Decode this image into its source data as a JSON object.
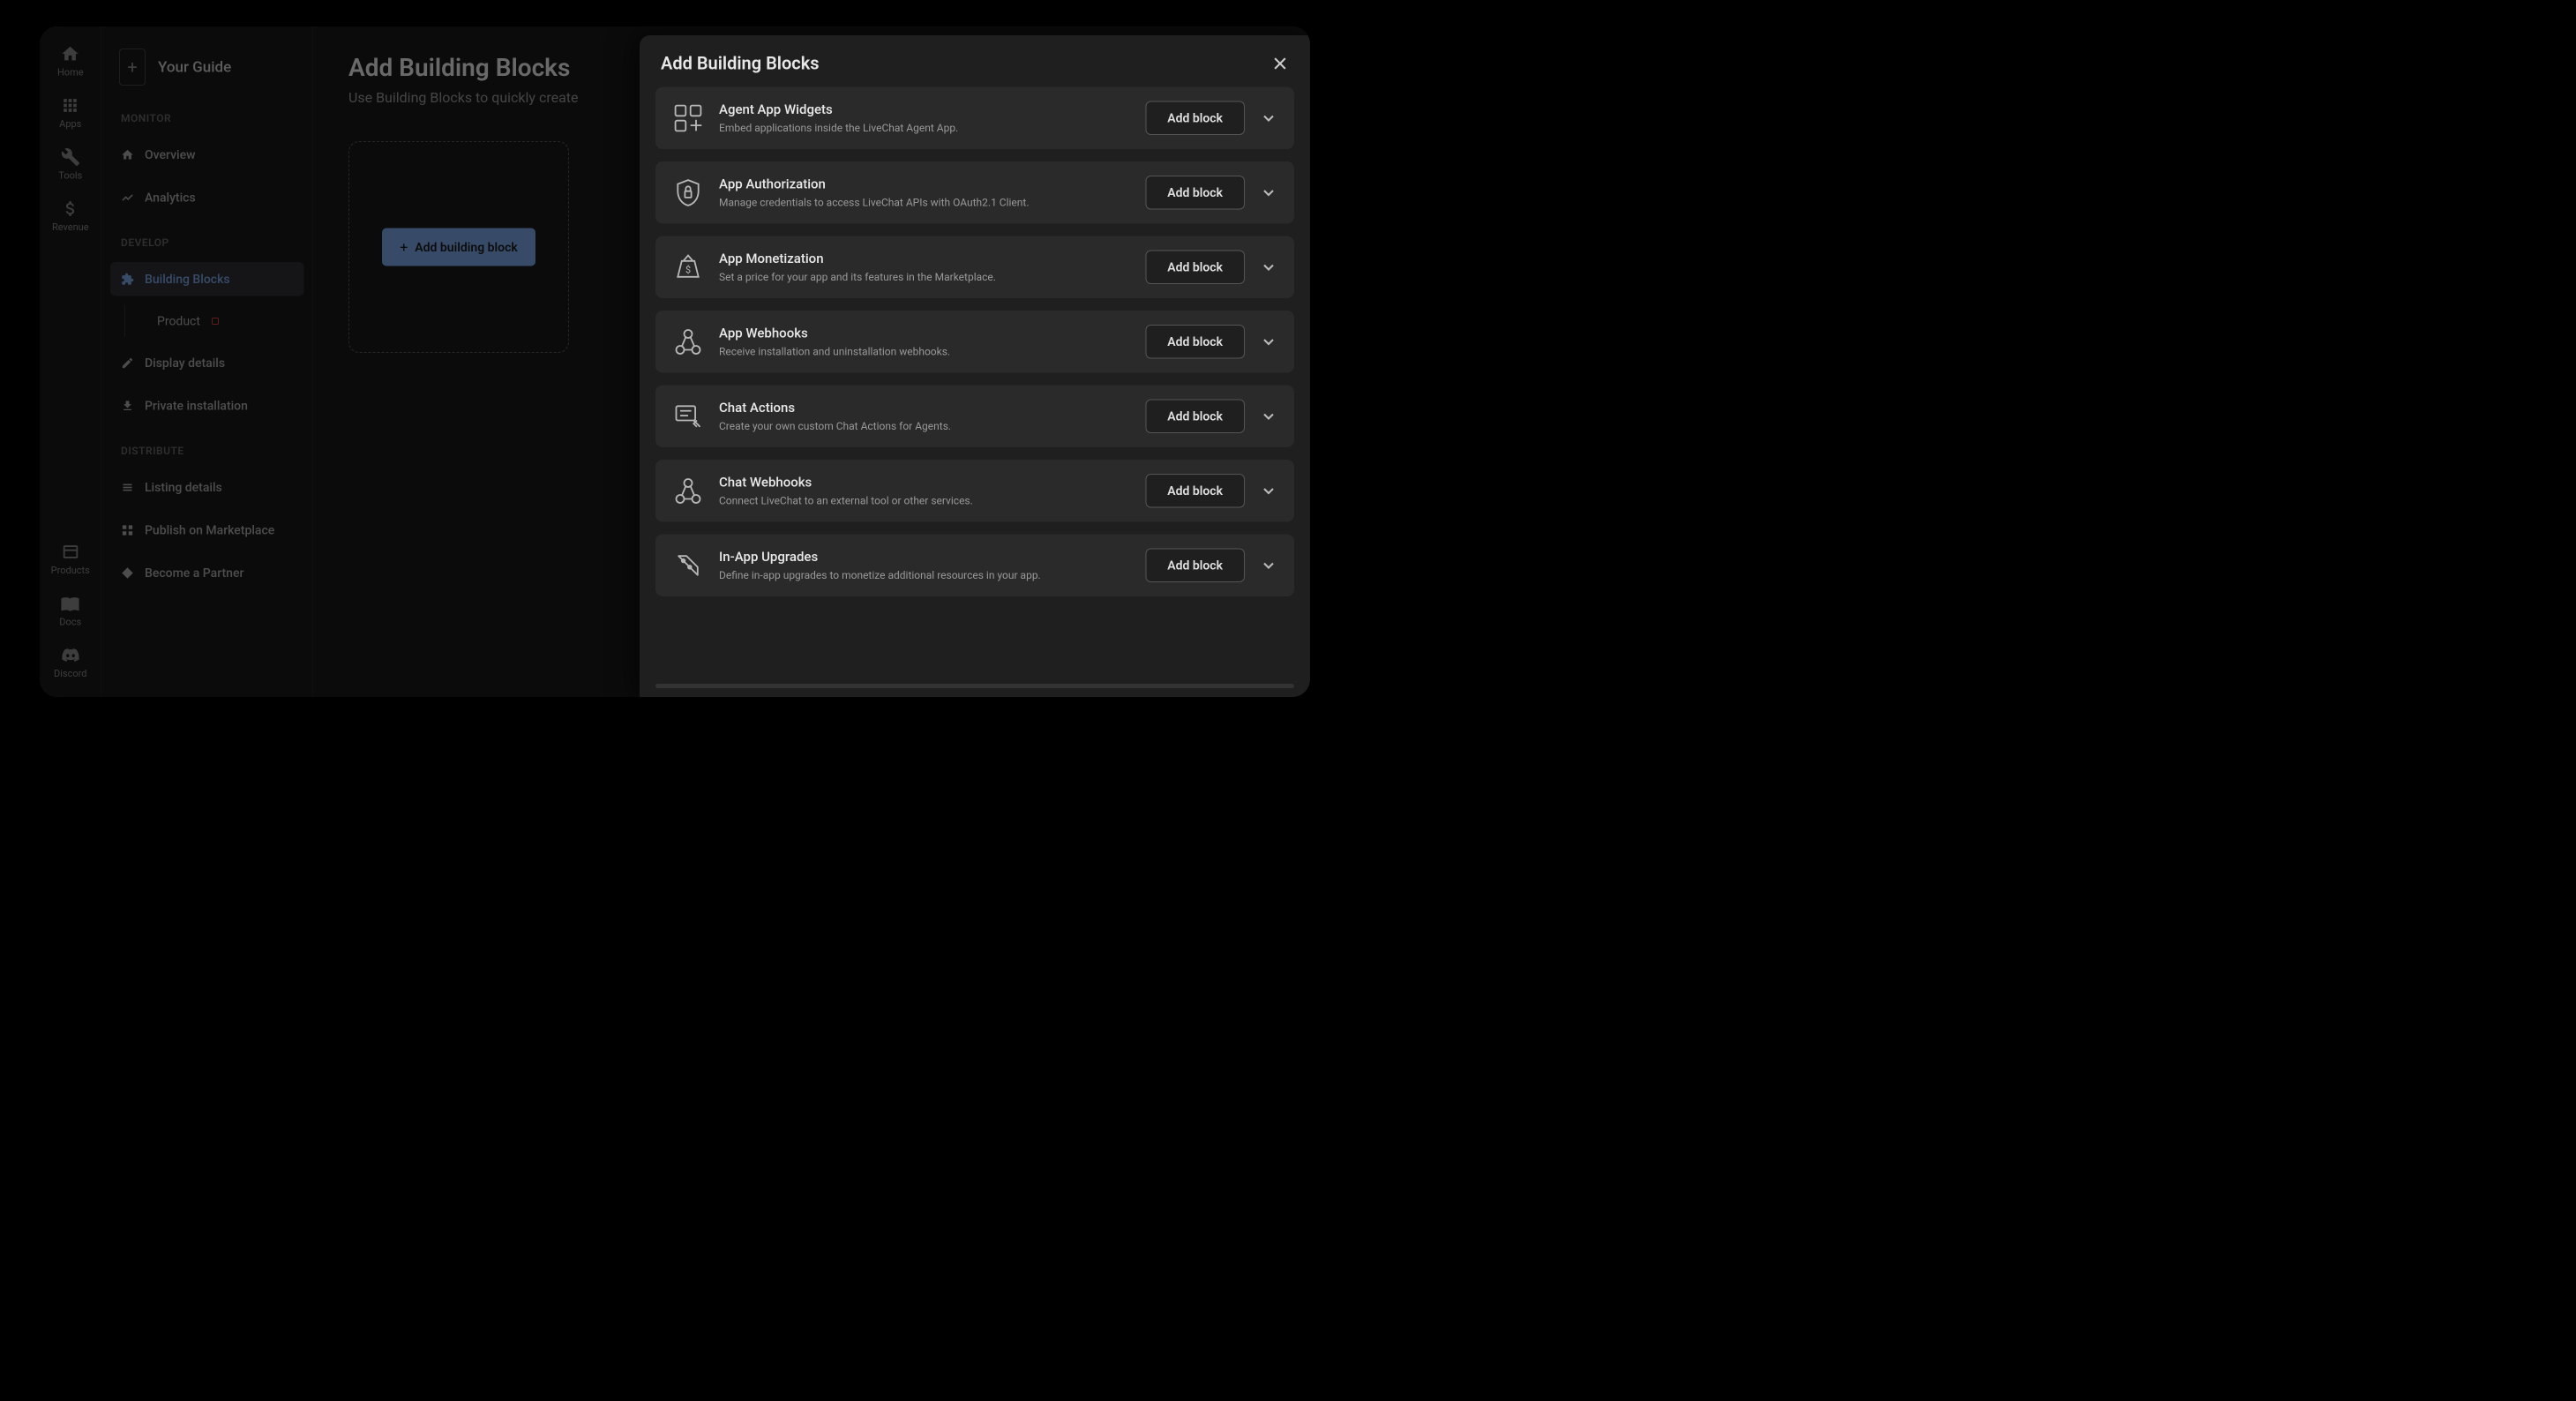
{
  "rail": {
    "top": [
      {
        "id": "home",
        "label": "Home"
      },
      {
        "id": "apps",
        "label": "Apps"
      },
      {
        "id": "tools",
        "label": "Tools"
      },
      {
        "id": "revenue",
        "label": "Revenue"
      }
    ],
    "bottom": [
      {
        "id": "products",
        "label": "Products"
      },
      {
        "id": "docs",
        "label": "Docs"
      },
      {
        "id": "discord",
        "label": "Discord"
      }
    ]
  },
  "sidebar": {
    "guide_label": "Your Guide",
    "sections": {
      "monitor": {
        "header": "MONITOR",
        "items": [
          {
            "id": "overview",
            "label": "Overview"
          },
          {
            "id": "analytics",
            "label": "Analytics"
          }
        ]
      },
      "develop": {
        "header": "DEVELOP",
        "items": [
          {
            "id": "building-blocks",
            "label": "Building Blocks",
            "active": true
          },
          {
            "id": "product",
            "label": "Product",
            "sub": true,
            "warn": true
          },
          {
            "id": "display-details",
            "label": "Display details"
          },
          {
            "id": "private-installation",
            "label": "Private installation"
          }
        ]
      },
      "distribute": {
        "header": "DISTRIBUTE",
        "items": [
          {
            "id": "listing-details",
            "label": "Listing details"
          },
          {
            "id": "publish-marketplace",
            "label": "Publish on Marketplace"
          },
          {
            "id": "become-partner",
            "label": "Become a Partner"
          }
        ]
      }
    }
  },
  "main": {
    "heading": "Add Building Blocks",
    "subtitle": "Use Building Blocks to quickly create",
    "add_button": "Add building block"
  },
  "modal": {
    "title": "Add Building Blocks",
    "add_label": "Add block",
    "blocks": [
      {
        "id": "agent-app-widgets",
        "title": "Agent App Widgets",
        "desc": "Embed applications inside the LiveChat Agent App."
      },
      {
        "id": "app-authorization",
        "title": "App Authorization",
        "desc": "Manage credentials to access LiveChat APIs with OAuth2.1 Client."
      },
      {
        "id": "app-monetization",
        "title": "App Monetization",
        "desc": "Set a price for your app and its features in the Marketplace."
      },
      {
        "id": "app-webhooks",
        "title": "App Webhooks",
        "desc": "Receive installation and uninstallation webhooks."
      },
      {
        "id": "chat-actions",
        "title": "Chat Actions",
        "desc": "Create your own custom Chat Actions for Agents."
      },
      {
        "id": "chat-webhooks",
        "title": "Chat Webhooks",
        "desc": "Connect LiveChat to an external tool or other services."
      },
      {
        "id": "in-app-upgrades",
        "title": "In-App Upgrades",
        "desc": "Define in-app upgrades to monetize additional resources in your app."
      }
    ]
  },
  "colors": {
    "accent": "#7aa7e8",
    "bg": "#1a1a1a",
    "panel": "#2a2a2a"
  }
}
